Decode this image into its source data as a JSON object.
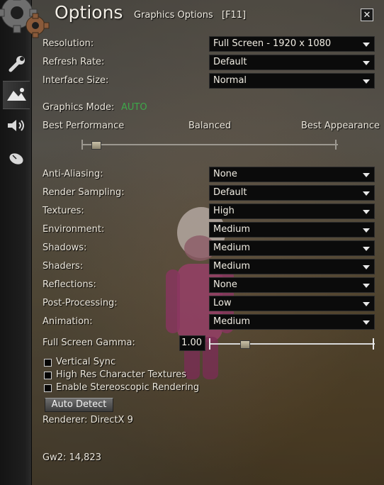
{
  "header": {
    "title": "Options",
    "subtitle": "Graphics Options",
    "hotkey": "[F11]",
    "close_glyph": "✕"
  },
  "sidebar": {
    "items": [
      {
        "icon": "wrench-icon",
        "active": false
      },
      {
        "icon": "mountains-icon",
        "active": true
      },
      {
        "icon": "speaker-icon",
        "active": false
      },
      {
        "icon": "mouse-icon",
        "active": false
      }
    ]
  },
  "display": {
    "resolution": {
      "label": "Resolution:",
      "value": "Full Screen - 1920 x 1080"
    },
    "refresh_rate": {
      "label": "Refresh Rate:",
      "value": "Default"
    },
    "interface_size": {
      "label": "Interface Size:",
      "value": "Normal"
    }
  },
  "graphics_mode": {
    "label": "Graphics Mode:",
    "value": "AUTO",
    "value_color": "#3da84a",
    "slider": {
      "left_label": "Best Performance",
      "mid_label": "Balanced",
      "right_label": "Best Appearance",
      "level": 0.04
    }
  },
  "settings": [
    {
      "label": "Anti-Aliasing:",
      "value": "None"
    },
    {
      "label": "Render Sampling:",
      "value": "Default"
    },
    {
      "label": "Textures:",
      "value": "High"
    },
    {
      "label": "Environment:",
      "value": "Medium"
    },
    {
      "label": "Shadows:",
      "value": "Medium"
    },
    {
      "label": "Shaders:",
      "value": "Medium"
    },
    {
      "label": "Reflections:",
      "value": "None"
    },
    {
      "label": "Post-Processing:",
      "value": "Low"
    },
    {
      "label": "Animation:",
      "value": "Medium"
    }
  ],
  "gamma": {
    "label": "Full Screen Gamma:",
    "value": "1.00",
    "level": 0.2
  },
  "checkboxes": [
    {
      "label": "Vertical Sync",
      "checked": false
    },
    {
      "label": "High Res Character Textures",
      "checked": false
    },
    {
      "label": "Enable Stereoscopic Rendering",
      "checked": false
    }
  ],
  "auto_detect_label": "Auto Detect",
  "renderer": "Renderer: DirectX 9",
  "build": "Gw2: 14,823"
}
